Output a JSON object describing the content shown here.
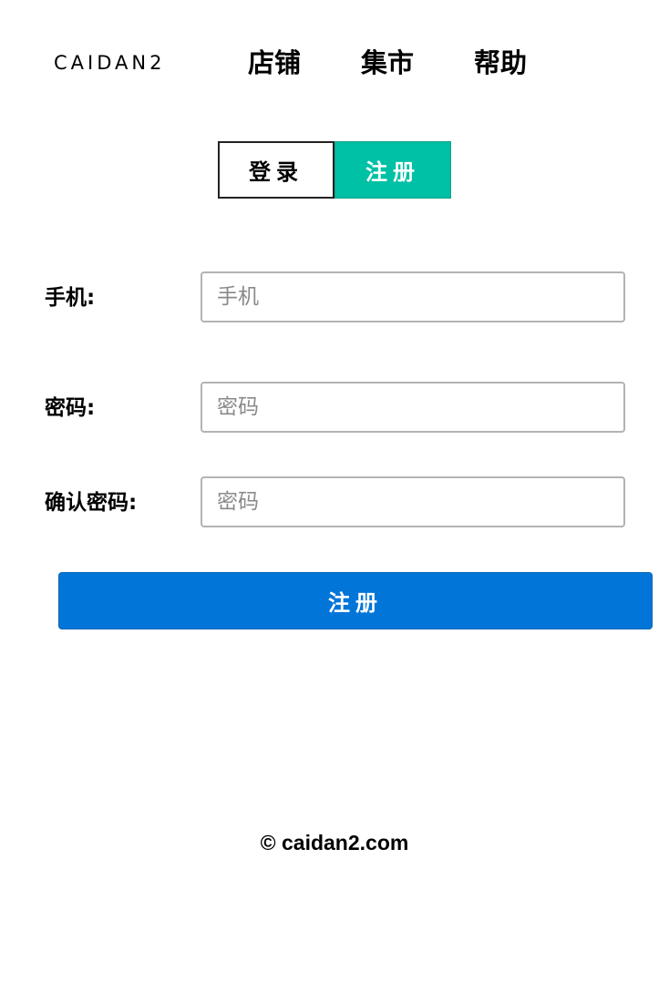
{
  "header": {
    "logo_text": "CAIDAN2",
    "nav": {
      "shop": "店铺",
      "market": "集市",
      "help": "帮助"
    }
  },
  "tabs": {
    "login": "登录",
    "register": "注册",
    "active": "register"
  },
  "form": {
    "phone": {
      "label": "手机:",
      "placeholder": "手机",
      "value": ""
    },
    "password": {
      "label": "密码:",
      "placeholder": "密码",
      "value": ""
    },
    "confirm_password": {
      "label": "确认密码:",
      "placeholder": "密码",
      "value": ""
    },
    "submit_label": "注册"
  },
  "footer": {
    "copyright": "© caidan2.com"
  },
  "colors": {
    "register_tab_bg": "#00c0a5",
    "submit_bg": "#0275d8",
    "input_border": "#b3b3b3"
  }
}
